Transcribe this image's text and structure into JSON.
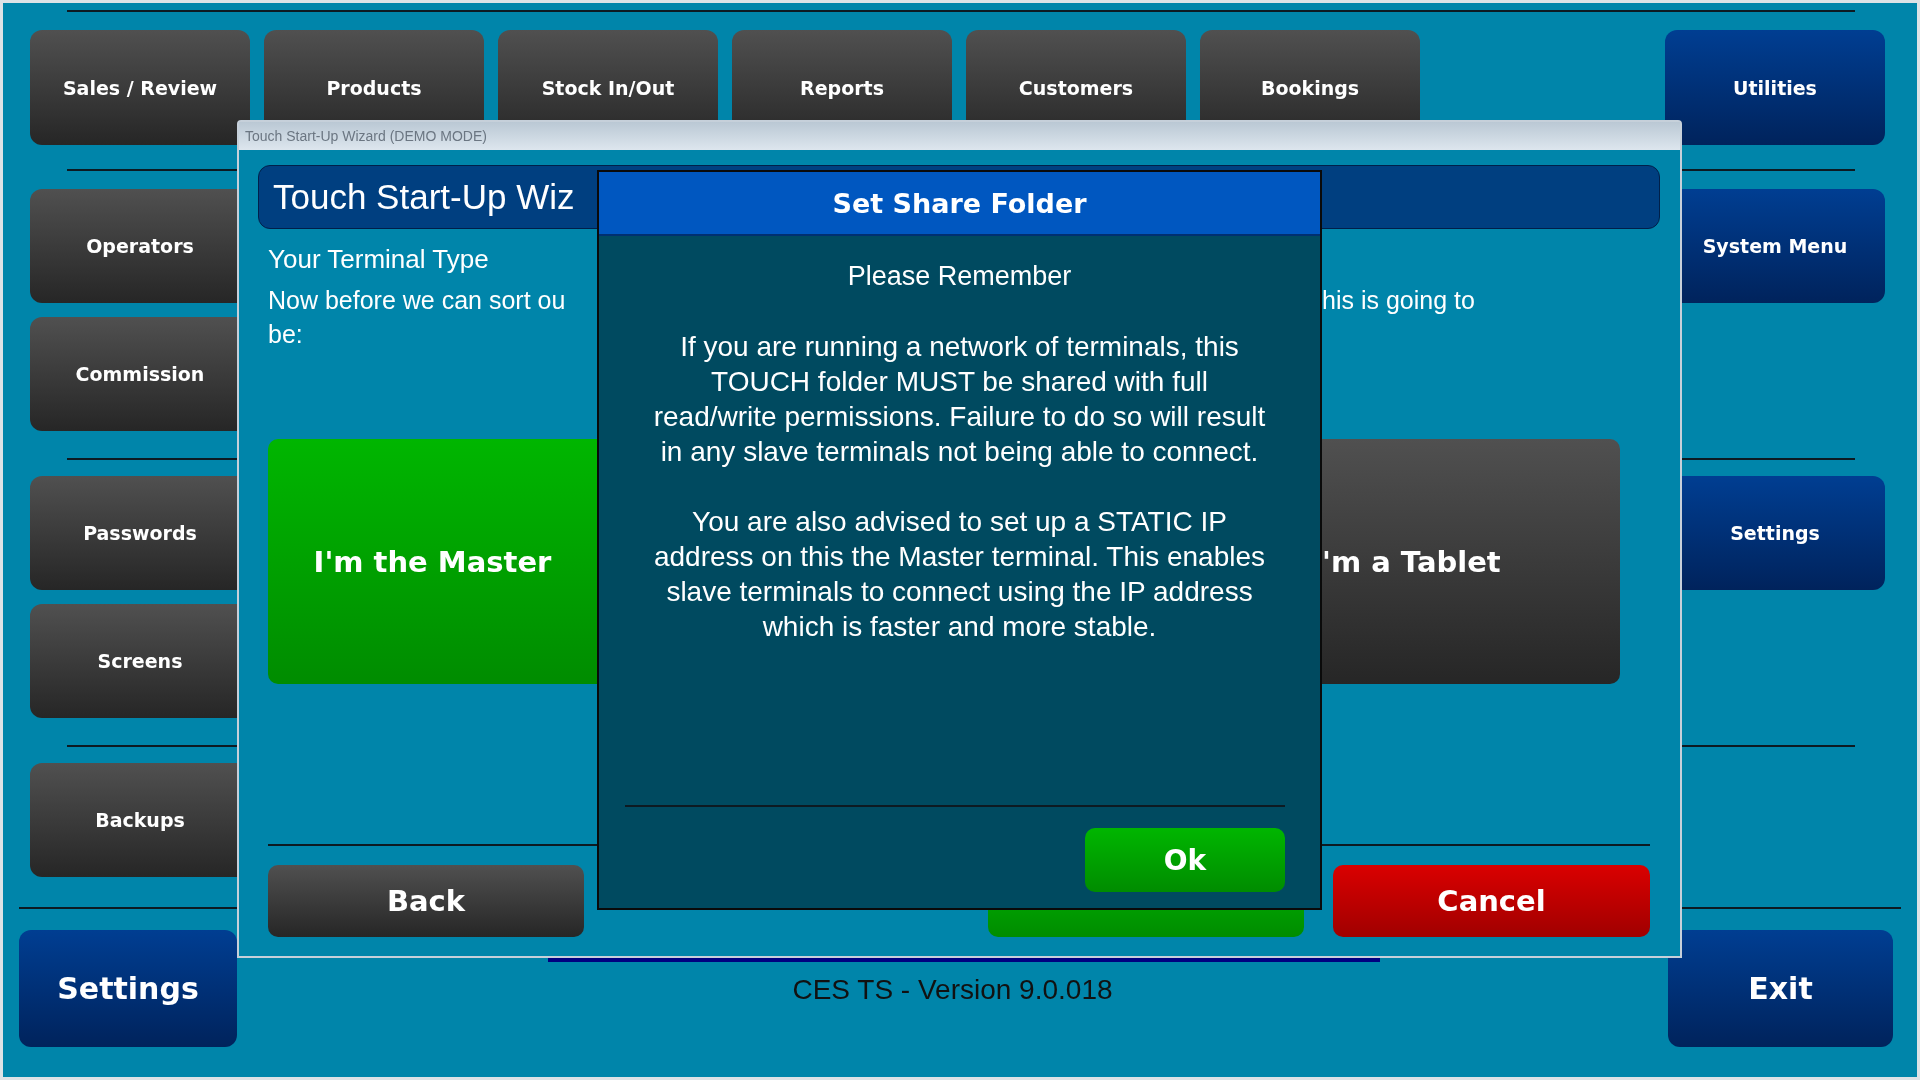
{
  "top_menu": [
    {
      "label": "Sales / Review"
    },
    {
      "label": "Products"
    },
    {
      "label": "Stock In/Out"
    },
    {
      "label": "Reports"
    },
    {
      "label": "Customers"
    },
    {
      "label": "Bookings"
    }
  ],
  "utilities": "Utilities",
  "left_menu": [
    [
      "Operators",
      "Commission"
    ],
    [
      "Passwords",
      "Screens"
    ],
    [
      "Backups"
    ]
  ],
  "right_menu": [
    "System Menu",
    "Settings"
  ],
  "bottom": {
    "settings": "Settings",
    "version": "CES TS - Version 9.0.018",
    "exit": "Exit"
  },
  "wizard": {
    "title": "Touch Start-Up Wizard (DEMO MODE)",
    "heading": "Touch Start-Up Wiz",
    "subheading": "Your Terminal Type",
    "intro_left": [
      "Now before we can sort ou",
      "be:"
    ],
    "intro_right": "his is going to",
    "options": [
      {
        "label": "I'm the Master",
        "kind": "accept"
      },
      {
        "label": "'m a Tablet",
        "kind": "plain"
      }
    ],
    "buttons": [
      {
        "label": "Back",
        "kind": "plain"
      },
      {
        "kind": "accept"
      },
      {
        "label": "Cancel",
        "kind": "danger"
      }
    ]
  },
  "dialog": {
    "title": "Set Share Folder",
    "subtitle": "Please Remember",
    "paragraphs": [
      "If you are running a network of terminals, this TOUCH folder MUST be shared with full read/write permissions. Failure to do so will result in any slave terminals not being able to connect.",
      "You are also advised to set up a STATIC IP address on this the Master terminal. This enables slave terminals to connect using the IP address which is faster and more stable."
    ],
    "ok": "Ok"
  }
}
